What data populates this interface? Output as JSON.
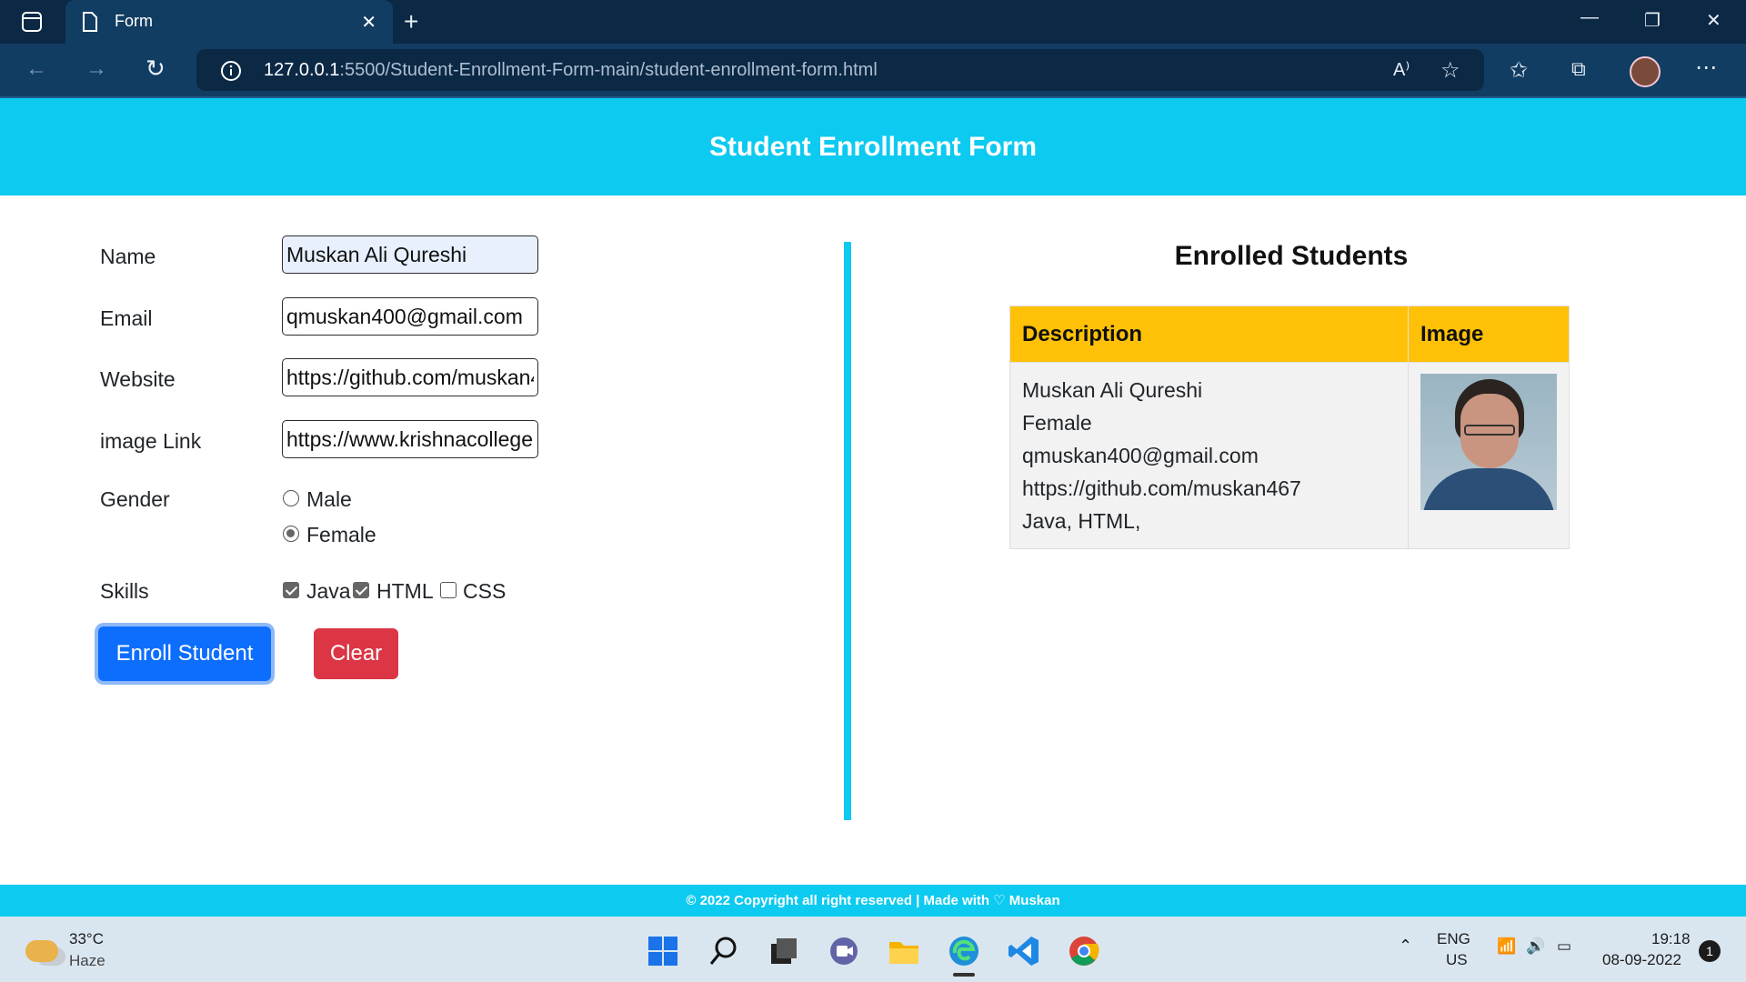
{
  "browser": {
    "tab_title": "Form",
    "url_host": "127.0.0.1",
    "url_rest": ":5500/Student-Enrollment-Form-main/student-enrollment-form.html",
    "icons": [
      "sidebar-icon",
      "page-icon",
      "close-icon",
      "new-tab-icon",
      "minimize-icon",
      "restore-icon",
      "window-close-icon",
      "back-icon",
      "forward-icon",
      "refresh-icon",
      "info-icon",
      "read-aloud-icon",
      "add-favorite-icon",
      "favorites-icon",
      "collections-icon",
      "profile-avatar",
      "more-icon"
    ]
  },
  "page": {
    "title": "Student Enrollment Form",
    "form": {
      "name_label": "Name",
      "name_value": "Muskan Ali Qureshi",
      "email_label": "Email",
      "email_value": "qmuskan400@gmail.com",
      "website_label": "Website",
      "website_value": "https://github.com/muskan467",
      "image_label": "image Link",
      "image_value": "https://www.krishnacollege.ac.in/",
      "gender_label": "Gender",
      "gender_options": [
        "Male",
        "Female"
      ],
      "gender_selected": "Female",
      "skills_label": "Skills",
      "skills": [
        {
          "label": "Java",
          "checked": true
        },
        {
          "label": "HTML",
          "checked": true
        },
        {
          "label": "CSS",
          "checked": false
        }
      ],
      "enroll_button": "Enroll Student",
      "clear_button": "Clear"
    },
    "enrolled": {
      "heading": "Enrolled Students",
      "columns": [
        "Description",
        "Image"
      ],
      "rows": [
        {
          "lines": [
            "Muskan Ali Qureshi",
            "Female",
            "qmuskan400@gmail.com",
            "https://github.com/muskan467",
            "Java, HTML,"
          ]
        }
      ]
    },
    "footer": "© 2022 Copyright all right reserved | Made with ♡ Muskan"
  },
  "taskbar": {
    "weather_temp": "33°C",
    "weather_desc": "Haze",
    "lang_top": "ENG",
    "lang_bottom": "US",
    "time": "19:18",
    "date": "08-09-2022",
    "notification_count": "1"
  },
  "colors": {
    "header": "#0dcaf0",
    "table_header": "#ffc107",
    "enroll": "#0d6efd",
    "clear": "#dc3545"
  }
}
